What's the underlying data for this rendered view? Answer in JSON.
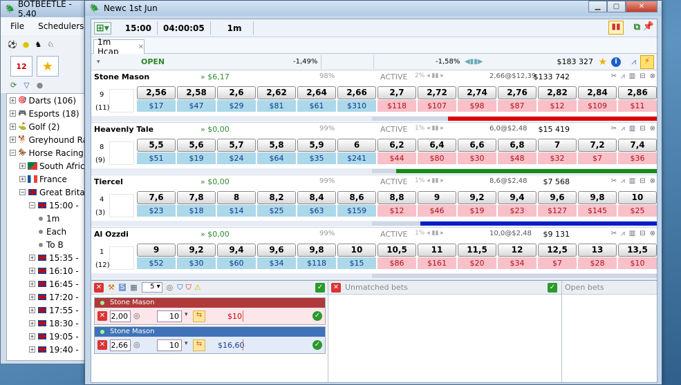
{
  "bg_window": {
    "title": "BOTBEETLE - 5.40",
    "menu": [
      "File",
      "Schedulers"
    ],
    "tree": [
      {
        "label": "Darts (106)",
        "level": 0
      },
      {
        "label": "Esports (18)",
        "level": 0
      },
      {
        "label": "Golf (2)",
        "level": 0
      },
      {
        "label": "Greyhound Ra",
        "level": 0
      },
      {
        "label": "Horse Racing",
        "level": 0
      },
      {
        "label": "South Afric",
        "level": 1,
        "flag": "za"
      },
      {
        "label": "France",
        "level": 1,
        "flag": "fr"
      },
      {
        "label": "Great Brita",
        "level": 1,
        "flag": "uk"
      },
      {
        "label": "15:00 -",
        "level": 2,
        "flag": "uk"
      },
      {
        "label": "1m",
        "level": 3
      },
      {
        "label": "Each",
        "level": 3
      },
      {
        "label": "To B",
        "level": 3
      },
      {
        "label": "15:35 -",
        "level": 2,
        "flag": "uk"
      },
      {
        "label": "16:10 -",
        "level": 2,
        "flag": "uk"
      },
      {
        "label": "16:45 -",
        "level": 2,
        "flag": "uk"
      },
      {
        "label": "17:20 -",
        "level": 2,
        "flag": "uk"
      },
      {
        "label": "17:55 -",
        "level": 2,
        "flag": "uk"
      },
      {
        "label": "18:30 -",
        "level": 2,
        "flag": "uk"
      },
      {
        "label": "19:05 -",
        "level": 2,
        "flag": "uk"
      },
      {
        "label": "19:40 -",
        "level": 2,
        "flag": "uk"
      }
    ]
  },
  "window": {
    "title": "Newc 1st Jun",
    "race_time": "15:00",
    "countdown": "04:00:05",
    "distance": "1m",
    "tab": "1m Hcap"
  },
  "status": {
    "state": "OPEN",
    "back_pct": "-1,49%",
    "lay_pct": "-1,58%",
    "matched": "$183 327"
  },
  "runners": [
    {
      "name": "Stone Mason",
      "pl": "» $6,17",
      "pct": "98%",
      "status": "ACTIVE",
      "small_pct": "2%",
      "last": "2,66@$12,39",
      "volume": "$133 742",
      "num": "9",
      "count": "(11)",
      "back_prices": [
        "2,56",
        "2,58",
        "2,6",
        "2,62",
        "2,64",
        "2,66"
      ],
      "back_vols": [
        "$17",
        "$47",
        "$29",
        "$81",
        "$61",
        "$310"
      ],
      "lay_prices": [
        "2,7",
        "2,72",
        "2,74",
        "2,76",
        "2,82",
        "2,84",
        "2,86"
      ],
      "lay_vols": [
        "$118",
        "$107",
        "$98",
        "$87",
        "$12",
        "$109",
        "$11"
      ],
      "color": "#e00000",
      "fill_start": 0.265
    },
    {
      "name": "Heavenly Tale",
      "pl": "» $0,00",
      "pct": "99%",
      "status": "ACTIVE",
      "small_pct": "1%",
      "last": "6,0@$2,48",
      "volume": "$15 419",
      "num": "8",
      "count": "(9)",
      "back_prices": [
        "5,5",
        "5,6",
        "5,7",
        "5,8",
        "5,9",
        "6"
      ],
      "back_vols": [
        "$51",
        "$19",
        "$24",
        "$64",
        "$35",
        "$241"
      ],
      "lay_prices": [
        "6,2",
        "6,4",
        "6,6",
        "6,8",
        "7",
        "7,2",
        "7,4"
      ],
      "lay_vols": [
        "$44",
        "$80",
        "$30",
        "$48",
        "$32",
        "$7",
        "$36"
      ],
      "color": "#168a16",
      "fill_start": 0.085
    },
    {
      "name": "Tiercel",
      "pl": "» $0,00",
      "pct": "99%",
      "status": "ACTIVE",
      "small_pct": "1%",
      "last": "8,6@$2,48",
      "volume": "$7 568",
      "num": "4",
      "count": "(3)",
      "back_prices": [
        "7,6",
        "7,8",
        "8",
        "8,2",
        "8,4",
        "8,6"
      ],
      "back_vols": [
        "$23",
        "$18",
        "$14",
        "$25",
        "$63",
        "$159"
      ],
      "lay_prices": [
        "8,8",
        "9",
        "9,2",
        "9,4",
        "9,6",
        "9,8",
        "10"
      ],
      "lay_vols": [
        "$12",
        "$46",
        "$19",
        "$23",
        "$127",
        "$145",
        "$25"
      ],
      "color": "#0a1ec8",
      "fill_start": 0.17
    },
    {
      "name": "Al Ozzdi",
      "pl": "» $0,00",
      "pct": "99%",
      "status": "ACTIVE",
      "small_pct": "1%",
      "last": "10,0@$2,48",
      "volume": "$9 131",
      "num": "1",
      "count": "(12)",
      "back_prices": [
        "9",
        "9,2",
        "9,4",
        "9,6",
        "9,8",
        "10"
      ],
      "back_vols": [
        "$52",
        "$30",
        "$60",
        "$34",
        "$118",
        "$15"
      ],
      "lay_prices": [
        "10,5",
        "11",
        "11,5",
        "12",
        "12,5",
        "13",
        "13,5"
      ],
      "lay_vols": [
        "$86",
        "$161",
        "$20",
        "$34",
        "$7",
        "$28",
        "$10"
      ],
      "color": "#cfd6e6",
      "fill_start": 1.0
    }
  ],
  "bottom": {
    "stake_select": "5",
    "unmatched_title": "Unmatched bets",
    "open_title": "Open bets",
    "bets": [
      {
        "runner": "Stone Mason",
        "odds": "2,00",
        "stake": "10",
        "value": "$10",
        "type": "lay"
      },
      {
        "runner": "Stone Mason",
        "odds": "2,66",
        "stake": "10",
        "value": "$16,60",
        "type": "back"
      }
    ]
  }
}
